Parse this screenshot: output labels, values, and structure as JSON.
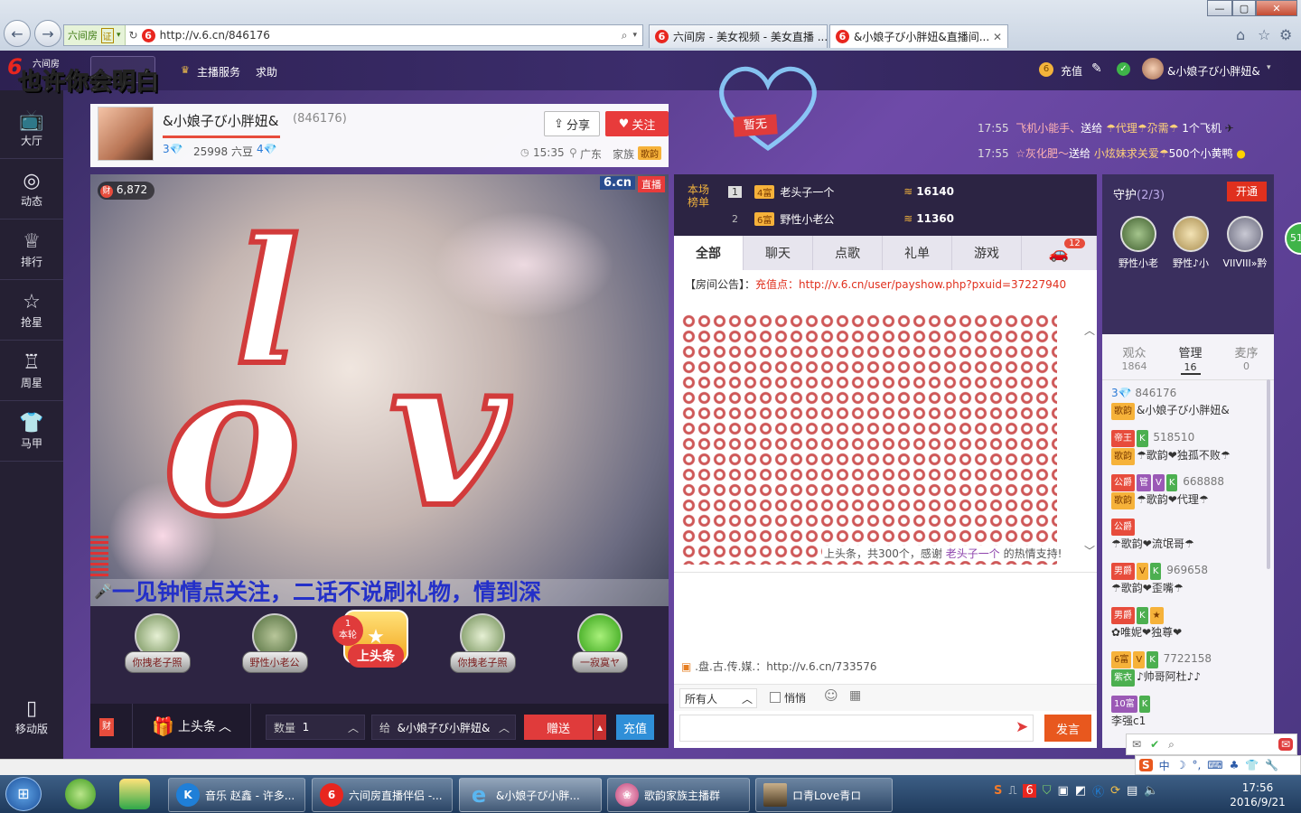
{
  "browser": {
    "site_tag": "六间房",
    "cert_tag": "证",
    "url": "http://v.6.cn/846176",
    "tabs": [
      {
        "label": "六间房 - 美女视频 - 美女直播 ..."
      },
      {
        "label": "&小娘子び小胖妞&直播间..."
      }
    ],
    "win_min": "—",
    "win_max": "▢",
    "win_close": "✕"
  },
  "overlay_text": "也许你会明白",
  "site": {
    "logo_six": "6",
    "logo_label": "六间房",
    "nav_links": [
      "主播服务",
      "求助"
    ],
    "recharge_label": "充值",
    "username": "&小娘子び小胖妞&"
  },
  "left_nav": [
    {
      "label": "大厅",
      "icon": "tv-icon"
    },
    {
      "label": "动态",
      "icon": "compass-icon"
    },
    {
      "label": "排行",
      "icon": "crown-icon"
    },
    {
      "label": "抢星",
      "icon": "star-icon"
    },
    {
      "label": "周星",
      "icon": "trophy-icon"
    },
    {
      "label": "马甲",
      "icon": "shirt-icon"
    }
  ],
  "mobile_label": "移动版",
  "host": {
    "name": "&小娘子び小胖妞&",
    "room_id": "(846176)",
    "level_left": "3",
    "level_right": "4",
    "beans": "25998 六豆",
    "share_label": "分享",
    "follow_label": "关注",
    "time": "15:35",
    "location": "广东",
    "family_label": "家族",
    "family_badge": "歌韵"
  },
  "heart_badge": "暂无",
  "notifications": [
    {
      "time": "17:55",
      "from": "飞机小能手、",
      "verb": "送给",
      "to": "☂代理☂尕需☂",
      "gift": "1个飞机"
    },
    {
      "time": "17:55",
      "from": "☆灰化肥～",
      "verb": "送给",
      "to": "小炫妹求关爱☂",
      "gift": "500个小黄鸭"
    }
  ],
  "video": {
    "wealth_count": "6,872",
    "brand": "6.cn",
    "live_tag": "直播",
    "scroll_text": "一见钟情点关注，二话不说刷礼物，情到深",
    "overlay_letters": "love"
  },
  "gifts": [
    {
      "label": "你拽老子照"
    },
    {
      "label": "野性小老公"
    },
    {
      "label": "上头条",
      "round_count": "1",
      "round_label": "本轮"
    },
    {
      "label": "你拽老子照"
    },
    {
      "label": "一寂寞ヤ"
    }
  ],
  "controls": {
    "wealth_icon": "财",
    "gift_selected": "上头条",
    "qty_label": "数量",
    "qty_value": "1",
    "to_label": "给",
    "to_value": "&小娘子び小胖妞&",
    "send_label": "赠送",
    "recharge_label": "充值"
  },
  "rank": {
    "title": "本场榜单",
    "rows": [
      {
        "pos": "1",
        "level": "4富",
        "name": "老头子一个",
        "score": "16140"
      },
      {
        "pos": "2",
        "level": "6富",
        "name": "野性小老公",
        "score": "11360"
      }
    ]
  },
  "chat": {
    "tabs": [
      "全部",
      "聊天",
      "点歌",
      "礼单",
      "游戏"
    ],
    "car_badge": "12",
    "announcement_label": "【房间公告】：",
    "announcement_text": "充值点：http://v.6.cn/user/payshow.php?pxuid=37227940",
    "thanks_pre": "上头条，共300个，感谢",
    "thanks_user": "老头子一个",
    "thanks_post": "的热情支持!",
    "link_text": ".盘.古.传.媒.：http://v.6.cn/733576",
    "target": "所有人",
    "whisper": "悄悄",
    "send_label": "发言"
  },
  "guard": {
    "title": "守护",
    "count": "(2/3)",
    "open_label": "开通",
    "members": [
      "野性小老",
      "野性♪小",
      "VIIVIII»黔"
    ]
  },
  "user_tabs": [
    {
      "label": "观众",
      "count": "1864"
    },
    {
      "label": "管理",
      "count": "16"
    },
    {
      "label": "麦序",
      "count": "0"
    }
  ],
  "user_list": [
    {
      "badges": [
        "3"
      ],
      "id": "846176",
      "family": "歌韵",
      "name": "&小娘子び小胖妞&"
    },
    {
      "badges": [
        "帝王",
        "K"
      ],
      "id": "518510",
      "family": "歌韵",
      "name": "☂歌韵❤独孤不败☂"
    },
    {
      "badges": [
        "公爵",
        "管",
        "V",
        "K"
      ],
      "id": "668888",
      "family": "歌韵",
      "name": "☂歌韵❤代理☂"
    },
    {
      "badges": [
        "公爵"
      ],
      "id": "",
      "family": "",
      "name": "☂歌韵❤流氓哥☂"
    },
    {
      "badges": [
        "男爵",
        "V",
        "K"
      ],
      "id": "969658",
      "family": "",
      "name": "☂歌韵❤歪嘴☂"
    },
    {
      "badges": [
        "男爵",
        "K",
        "★"
      ],
      "id": "",
      "family": "",
      "name": "✿唯妮❤独尊❤"
    },
    {
      "badges": [
        "6富",
        "V",
        "K"
      ],
      "id": "7722158",
      "family": "紫衣",
      "name": "♪帅哥阿杜♪♪"
    },
    {
      "badges": [
        "10富",
        "K"
      ],
      "id": "",
      "family": "",
      "name": "李强c1"
    }
  ],
  "taskbar": {
    "items": [
      {
        "label": "音乐 赵鑫 - 许多...",
        "icon": "K"
      },
      {
        "label": "六间房直播伴侣 -...",
        "icon": "6"
      },
      {
        "label": "&小娘子び小胖...",
        "icon": "e"
      },
      {
        "label": "歌韵家族主播群",
        "icon": "❀"
      },
      {
        "label": "ロ青Love青ロ",
        "icon": ""
      }
    ],
    "ime": "中",
    "time": "17:56",
    "date": "2016/9/21"
  },
  "side_circle": "51"
}
